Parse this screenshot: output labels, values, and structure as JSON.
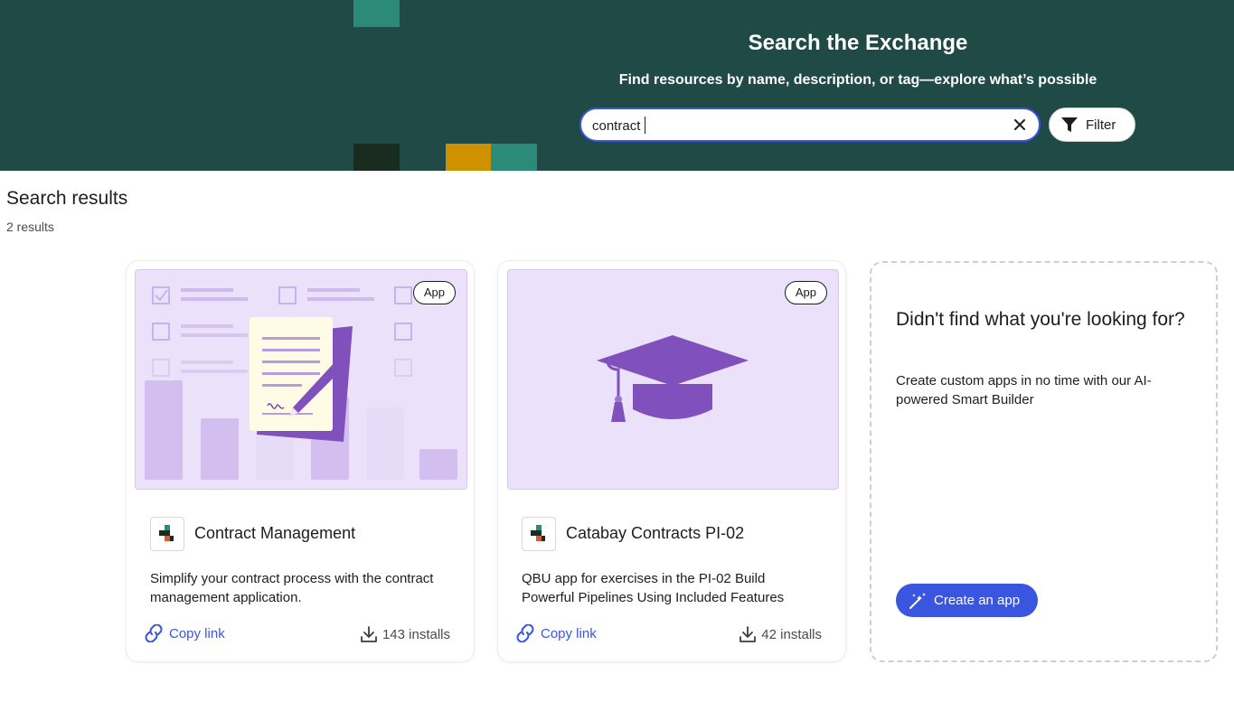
{
  "hero": {
    "title": "Search the Exchange",
    "subtitle": "Find resources by name, description, or tag—explore what’s possible",
    "search_value": "contract",
    "filter_label": "Filter"
  },
  "results": {
    "title": "Search results",
    "count": "2 results"
  },
  "cards": [
    {
      "badge": "App",
      "name": "Contract Management",
      "description": "Simplify your contract process with the contract management application.",
      "copy_link": "Copy link",
      "installs": "143 installs"
    },
    {
      "badge": "App",
      "name": "Catabay Contracts PI-02",
      "description": "QBU app for exercises in the PI-02 Build Powerful Pipelines Using Included Features",
      "copy_link": "Copy link",
      "installs": "42 installs"
    }
  ],
  "empty_card": {
    "title": "Didn't find what you're looking for?",
    "description": "Create custom apps in no time with our AI-powered Smart Builder",
    "button": "Create an app"
  },
  "icons": {
    "clear": "close-icon",
    "filter": "filter-icon",
    "link": "link-icon",
    "download": "download-icon",
    "magic": "magic-wand-icon"
  },
  "colors": {
    "hero_bg": "#1f4a45",
    "accent": "#3a55e0",
    "card_image_bg": "#ece1fb",
    "purple": "#8050bd"
  }
}
